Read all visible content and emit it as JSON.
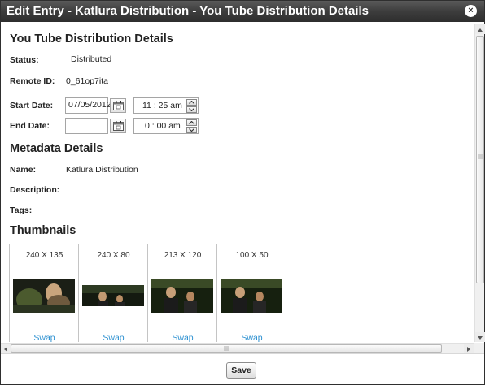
{
  "window": {
    "title": "Edit Entry - Katlura Distribution - You Tube Distribution Details",
    "close_glyph": "×"
  },
  "distribution": {
    "heading": "You Tube Distribution Details",
    "status_label": "Status:",
    "status_value": "Distributed",
    "remote_id_label": "Remote ID:",
    "remote_id_value": "0_61op7ita",
    "start_date_label": "Start Date:",
    "start_date_value": "07/05/2012",
    "start_time": "11 : 25  am",
    "end_date_label": "End Date:",
    "end_date_value": "",
    "end_time": "0 : 00  am"
  },
  "metadata": {
    "heading": "Metadata Details",
    "name_label": "Name:",
    "name_value": "Katlura Distribution",
    "description_label": "Description:",
    "tags_label": "Tags:"
  },
  "thumbnails": {
    "heading": "Thumbnails",
    "items": [
      {
        "size": "240 X 135",
        "swap": "Swap"
      },
      {
        "size": "240 X 80",
        "swap": "Swap"
      },
      {
        "size": "213 X 120",
        "swap": "Swap"
      },
      {
        "size": "100 X 50",
        "swap": "Swap"
      }
    ]
  },
  "footer": {
    "save_label": "Save"
  },
  "icons": {
    "close": "close-icon",
    "calendar": "calendar-icon",
    "spin_up": "chevron-up-icon",
    "spin_down": "chevron-down-icon",
    "scroll_up": "scroll-up-arrow-icon",
    "scroll_down": "scroll-down-arrow-icon",
    "scroll_left": "scroll-left-arrow-icon",
    "scroll_right": "scroll-right-arrow-icon"
  },
  "colors": {
    "titlebar": "#3d3d3d",
    "link": "#2a8fd0"
  }
}
